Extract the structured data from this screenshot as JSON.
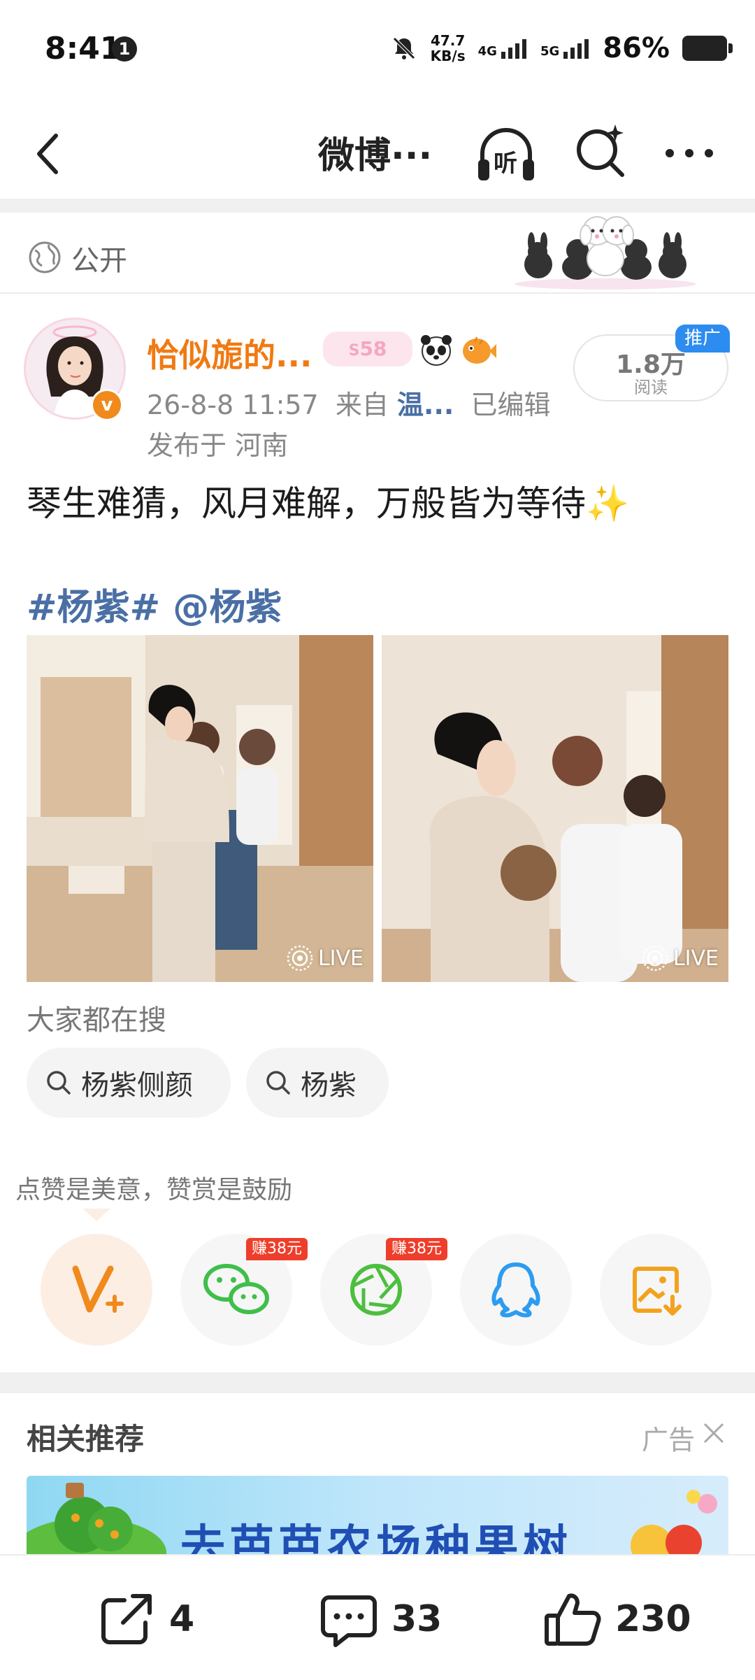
{
  "status_bar": {
    "time": "8:41",
    "notification_count": "1",
    "net_speed_value": "47.7",
    "net_speed_unit": "KB/s",
    "network_1": "4G",
    "network_2": "5G",
    "battery": "86%"
  },
  "header": {
    "title": "微博···",
    "listen_label": "听"
  },
  "visibility": {
    "label": "公开"
  },
  "post": {
    "author": "恰似旎的...",
    "level_badge": "58",
    "timestamp": "26-8-8 11:57",
    "source_prefix": "来自",
    "source": "温...",
    "edited": "已编辑",
    "location": "发布于 河南",
    "read_count": "1.8万",
    "read_label": "阅读",
    "promo_tag": "推广",
    "text": "琴生难猜，风月难解，万般皆为等待✨",
    "hashtags": "#杨紫# @杨紫",
    "photos": [
      {
        "live_label": "LIVE"
      },
      {
        "live_label": "LIVE"
      }
    ]
  },
  "trending": {
    "title": "大家都在搜",
    "chips": [
      "杨紫侧颜",
      "杨紫"
    ]
  },
  "reward": {
    "tagline": "点赞是美意，赞赏是鼓励",
    "earn_badges": [
      "赚38元",
      "赚38元"
    ]
  },
  "related": {
    "title": "相关推荐",
    "ad_label": "广告",
    "ad_banner_text": "去芭芭农场种果树"
  },
  "bottom_bar": {
    "repost_count": "4",
    "comment_count": "33",
    "like_count": "230"
  },
  "colors": {
    "author_orange": "#f07a12",
    "link_blue": "#4a6fa5",
    "earn_red": "#ee3e2b",
    "vplus_orange": "#f08a1c"
  }
}
